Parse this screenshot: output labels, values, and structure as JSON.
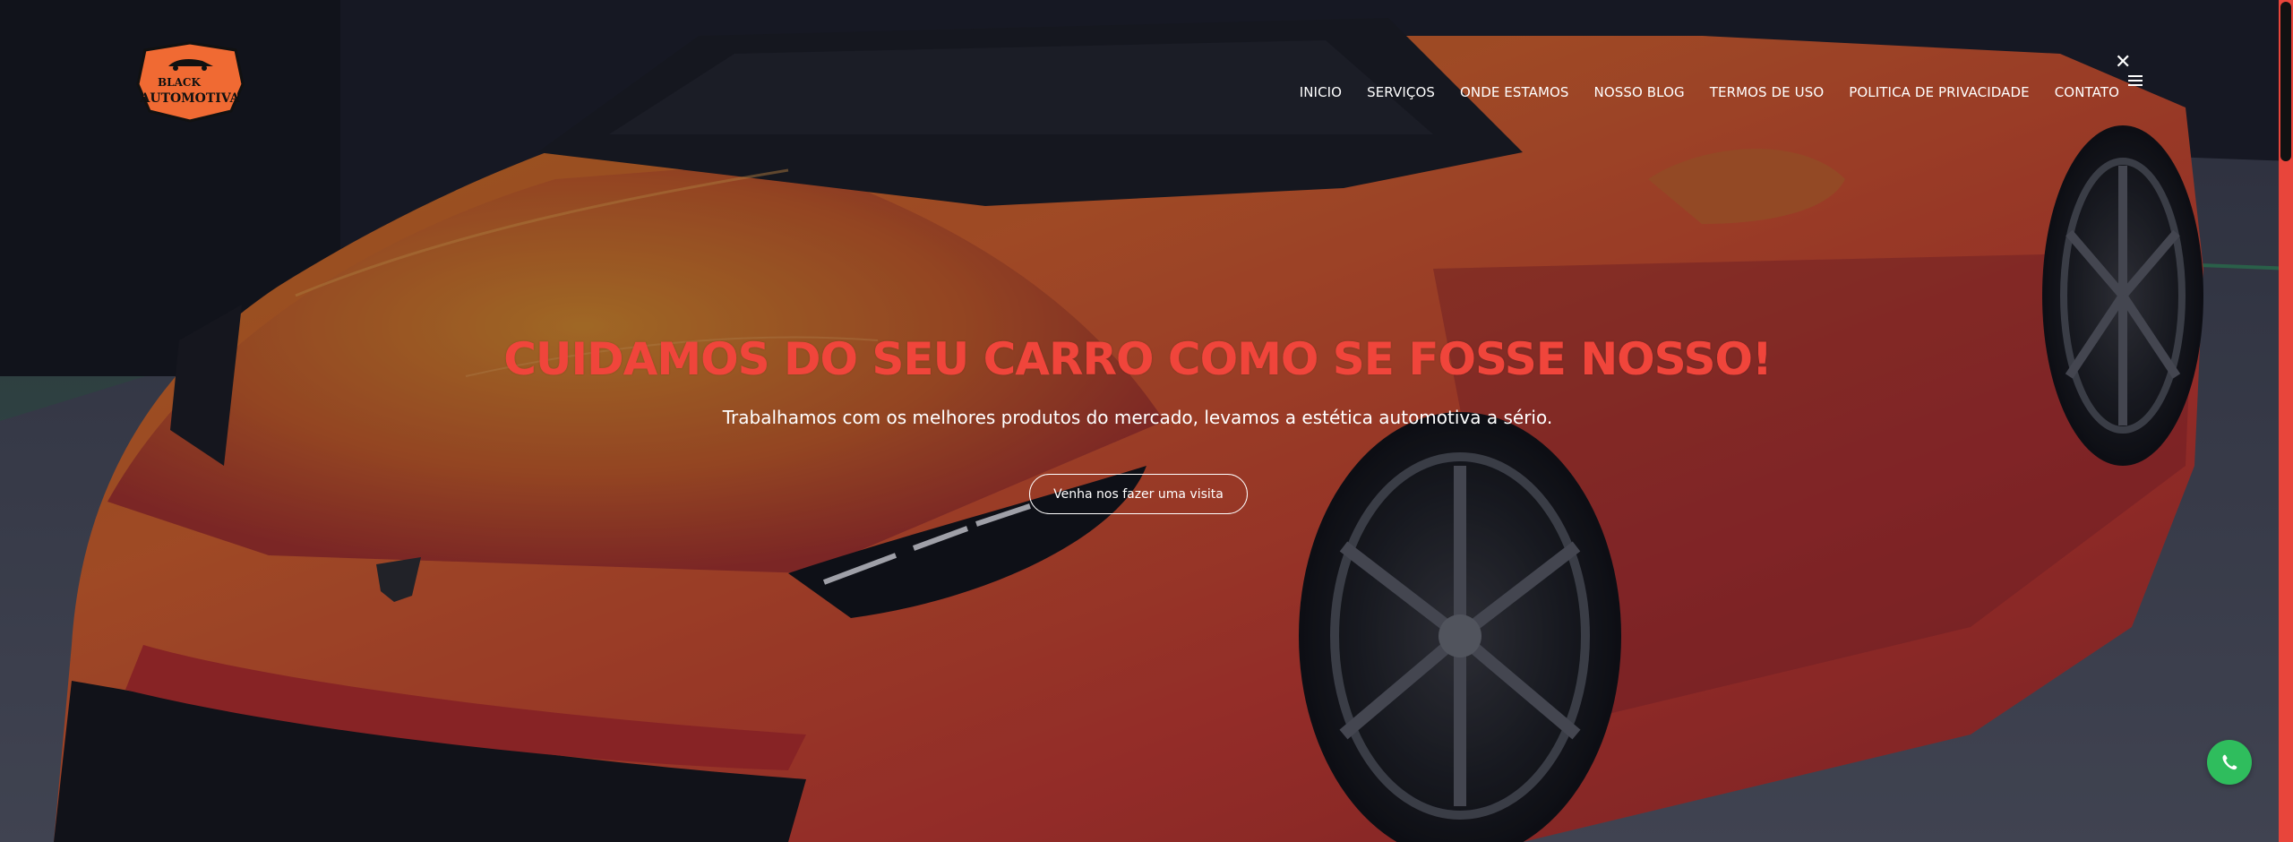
{
  "brand": {
    "logo_text_line1": "BLACK",
    "logo_text_line2": "AUTOMOTIVA",
    "accent": "#f0453b",
    "orange": "#f06a33"
  },
  "nav": {
    "items": [
      {
        "label": "INICIO"
      },
      {
        "label": "SERVIÇOS"
      },
      {
        "label": "ONDE ESTAMOS"
      },
      {
        "label": "NOSSO BLOG"
      },
      {
        "label": "TERMOS DE USO"
      },
      {
        "label": "POLITICA DE PRIVACIDADE"
      },
      {
        "label": "CONTATO"
      }
    ],
    "close_icon": "close-icon",
    "menu_icon": "hamburger-icon"
  },
  "hero": {
    "headline": "CUIDAMOS DO SEU CARRO COMO SE FOSSE NOSSO!",
    "subtitle": "Trabalhamos com os melhores produtos do mercado, levamos a estética automotiva a sério.",
    "cta_label": "Venha nos fazer uma visita"
  },
  "floating": {
    "whatsapp_icon": "whatsapp-icon",
    "whatsapp_color": "#2fbd5d"
  }
}
